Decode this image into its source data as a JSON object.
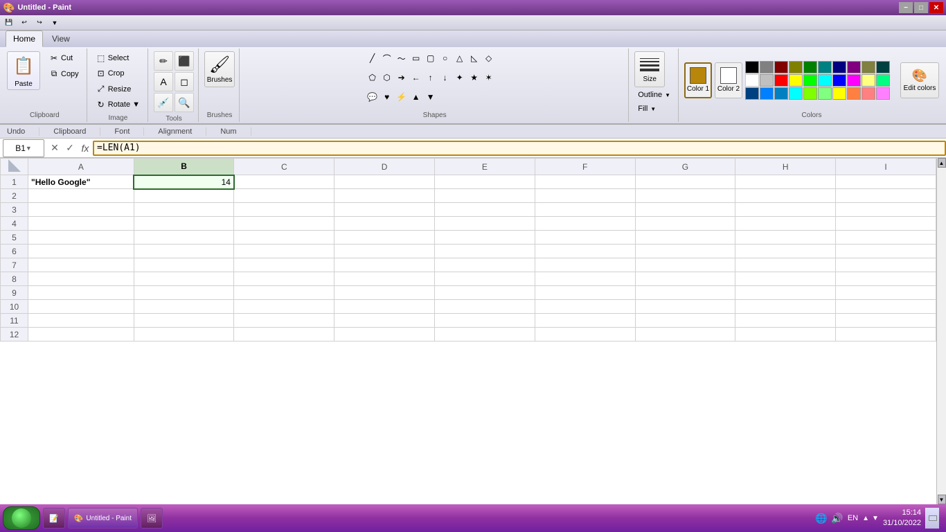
{
  "window": {
    "title": "Untitled - Paint",
    "min_btn": "−",
    "max_btn": "□",
    "close_btn": "✕"
  },
  "qat": {
    "save_tooltip": "Save",
    "undo_tooltip": "Undo",
    "redo_tooltip": "Redo",
    "dropdown_tooltip": "Customize Quick Access Toolbar"
  },
  "ribbon": {
    "tabs": [
      {
        "id": "home",
        "label": "Home",
        "active": true
      },
      {
        "id": "view",
        "label": "View",
        "active": false
      }
    ],
    "groups": {
      "clipboard": {
        "label": "Clipboard",
        "paste": "Paste",
        "cut": "Cut",
        "copy": "Copy"
      },
      "image": {
        "label": "Image",
        "crop": "Crop",
        "resize": "Resize",
        "rotate": "Rotate ▼",
        "select": "Select"
      },
      "tools": {
        "label": "Tools"
      },
      "shapes": {
        "label": "Shapes"
      },
      "size": {
        "label": "",
        "size_label": "Size",
        "outline_label": "Outline ▼",
        "fill_label": "Fill ▼"
      },
      "colors": {
        "label": "Colors",
        "color1_label": "Color 1",
        "color2_label": "Color 2",
        "edit_label": "Edit colors"
      }
    }
  },
  "section_labels": [
    "Undo",
    "Clipboard",
    "Font",
    "Alignment",
    "Num"
  ],
  "formula_bar": {
    "cell_ref": "B1",
    "formula": "=LEN(A1)",
    "cancel_symbol": "✕",
    "confirm_symbol": "✓",
    "fx_symbol": "fx"
  },
  "spreadsheet": {
    "columns": [
      "A",
      "B",
      "C",
      "D",
      "E",
      "F",
      "G",
      "H",
      "I"
    ],
    "rows": [
      1,
      2,
      3,
      4,
      5,
      6,
      7,
      8,
      9,
      10,
      11,
      12
    ],
    "cells": {
      "A1": "\"Hello Google\"",
      "B1": "14"
    },
    "selected_cell": "B1",
    "selected_col": "B"
  },
  "colors": {
    "color1": "#B8860B",
    "color2": "#FFFFFF",
    "palette_row1": [
      "#000000",
      "#808080",
      "#800000",
      "#808000",
      "#008000",
      "#008080",
      "#000080",
      "#800080",
      "#808040",
      "#004040"
    ],
    "palette_row2": [
      "#FFFFFF",
      "#C0C0C0",
      "#FF0000",
      "#FFFF00",
      "#00FF00",
      "#00FFFF",
      "#0000FF",
      "#FF00FF",
      "#FFFF80",
      "#00FF80"
    ],
    "palette_row3": [
      "#004080",
      "#0080FF",
      "#0080C0",
      "#00FFFF",
      "#80FF00",
      "#80FF80",
      "#FFFF00",
      "#FF8040",
      "#FF8080",
      "#FF80FF"
    ]
  },
  "taskbar": {
    "time": "15:14",
    "date": "31/10/2022",
    "start_label": "",
    "items": [
      {
        "id": "word",
        "label": ""
      },
      {
        "id": "paint",
        "label": ""
      }
    ],
    "lang": "EN"
  }
}
